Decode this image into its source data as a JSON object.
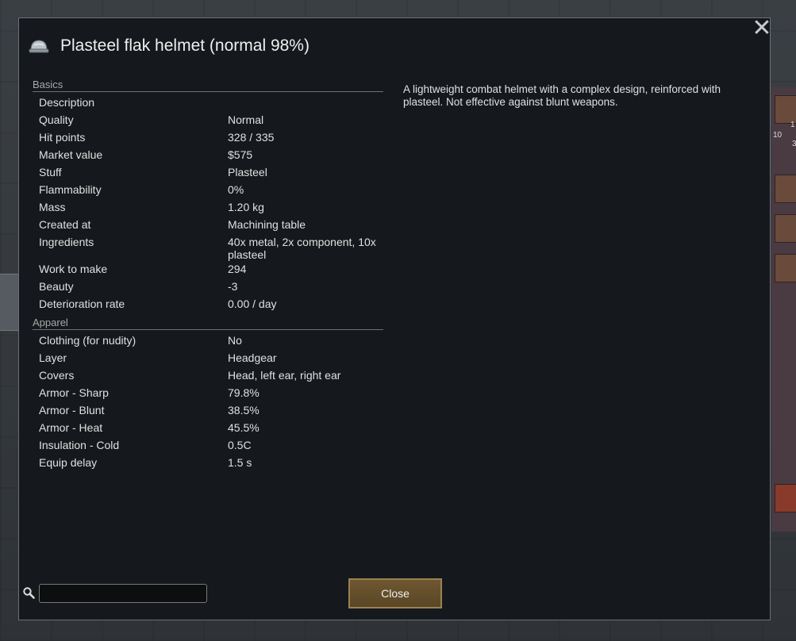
{
  "dialog": {
    "title": "Plasteel flak helmet (normal 98%)",
    "description": "A lightweight combat helmet with a complex design, reinforced with plasteel. Not effective against blunt weapons."
  },
  "stats": {
    "basics_header": "Basics",
    "basics": [
      {
        "label": "Description",
        "value": ""
      },
      {
        "label": "Quality",
        "value": "Normal"
      },
      {
        "label": "Hit points",
        "value": "328 / 335"
      },
      {
        "label": "Market value",
        "value": "$575"
      },
      {
        "label": "Stuff",
        "value": "Plasteel"
      },
      {
        "label": "Flammability",
        "value": "0%"
      },
      {
        "label": "Mass",
        "value": "1.20 kg"
      },
      {
        "label": "Created at",
        "value": "Machining table"
      },
      {
        "label": "Ingredients",
        "value": "40x metal, 2x component, 10x plasteel"
      },
      {
        "label": "Work to make",
        "value": "294"
      },
      {
        "label": "Beauty",
        "value": "-3"
      },
      {
        "label": "Deterioration rate",
        "value": "0.00 / day"
      }
    ],
    "apparel_header": "Apparel",
    "apparel": [
      {
        "label": "Clothing (for nudity)",
        "value": "No"
      },
      {
        "label": "Layer",
        "value": "Headgear"
      },
      {
        "label": "Covers",
        "value": "Head, left ear, right ear"
      },
      {
        "label": "Armor - Sharp",
        "value": "79.8%"
      },
      {
        "label": "Armor - Blunt",
        "value": "38.5%"
      },
      {
        "label": "Armor - Heat",
        "value": "45.5%"
      },
      {
        "label": "Insulation - Cold",
        "value": "0.5C"
      },
      {
        "label": "Equip delay",
        "value": "1.5 s"
      }
    ]
  },
  "footer": {
    "search_value": "",
    "close_label": "Close"
  },
  "background": {
    "right_numbers": [
      "10",
      "1",
      "3"
    ]
  }
}
